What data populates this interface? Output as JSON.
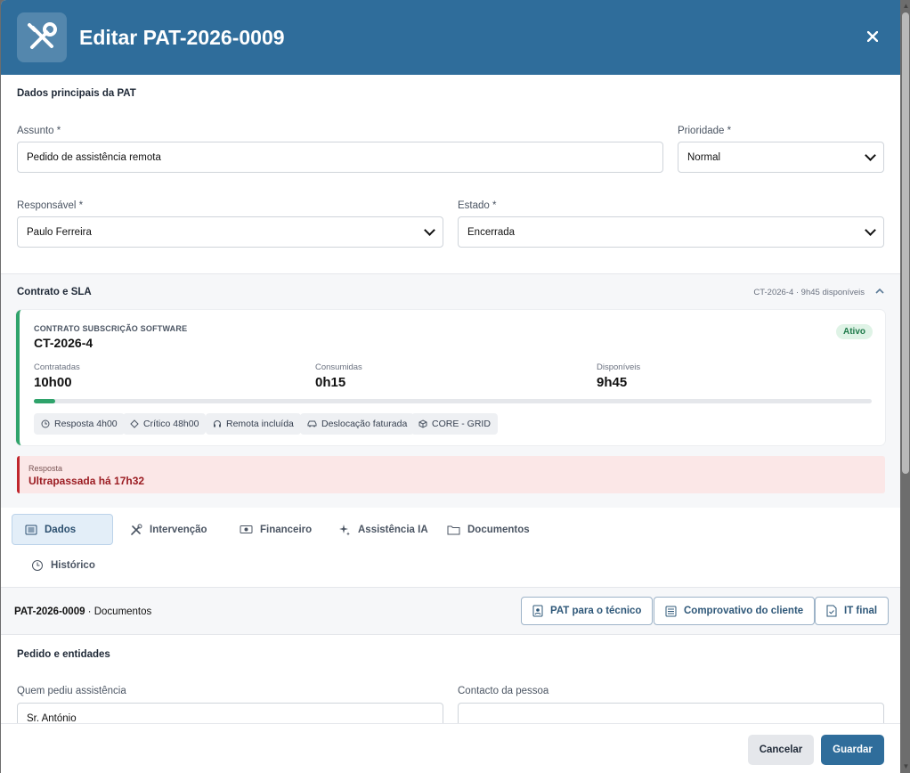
{
  "header": {
    "title": "Editar PAT-2026-0009",
    "icon": "tools-icon",
    "color": "#2f6d9b"
  },
  "main": {
    "section_title": "Dados principais da PAT",
    "assunto": {
      "label": "Assunto *",
      "value": "Pedido de assistência remota"
    },
    "prioridade": {
      "label": "Prioridade *",
      "value": "Normal"
    },
    "responsavel": {
      "label": "Responsável *",
      "value": "Paulo Ferreira"
    },
    "estado": {
      "label": "Estado *",
      "value": "Encerrada"
    }
  },
  "contract": {
    "section_title": "Contrato e SLA",
    "summary": "CT-2026-4 · 9h45 disponíveis",
    "type": "CONTRATO SUBSCRIÇÃO SOFTWARE",
    "id": "CT-2026-4",
    "status": "Ativo",
    "contratadas_label": "Contratadas",
    "contratadas": "10h00",
    "consumidas_label": "Consumidas",
    "consumidas": "0h15",
    "disponiveis_label": "Disponíveis",
    "disponiveis": "9h45",
    "progress": 0.025,
    "chips": [
      "Resposta 4h00",
      "Crítico 48h00",
      "Remota incluída",
      "Deslocação faturada",
      "CORE - GRID"
    ],
    "accent": "#2fa36b"
  },
  "alert": {
    "label": "Resposta",
    "value": "Ultrapassada há 17h32",
    "color": "#c0262d"
  },
  "tabs": [
    "Dados",
    "Intervenção",
    "Financeiro",
    "Assistência IA",
    "Documentos",
    "Histórico"
  ],
  "documents": {
    "pat_id": "PAT-2026-0009",
    "suffix": "Documentos",
    "buttons": [
      "PAT para o técnico",
      "Comprovativo do cliente",
      "IT final"
    ]
  },
  "pedido": {
    "section_title": "Pedido e entidades",
    "quem_label": "Quem pediu assistência",
    "quem_value": "Sr. António",
    "contacto_label": "Contacto da pessoa",
    "contacto_value": ""
  },
  "footer": {
    "cancel": "Cancelar",
    "save": "Guardar"
  }
}
